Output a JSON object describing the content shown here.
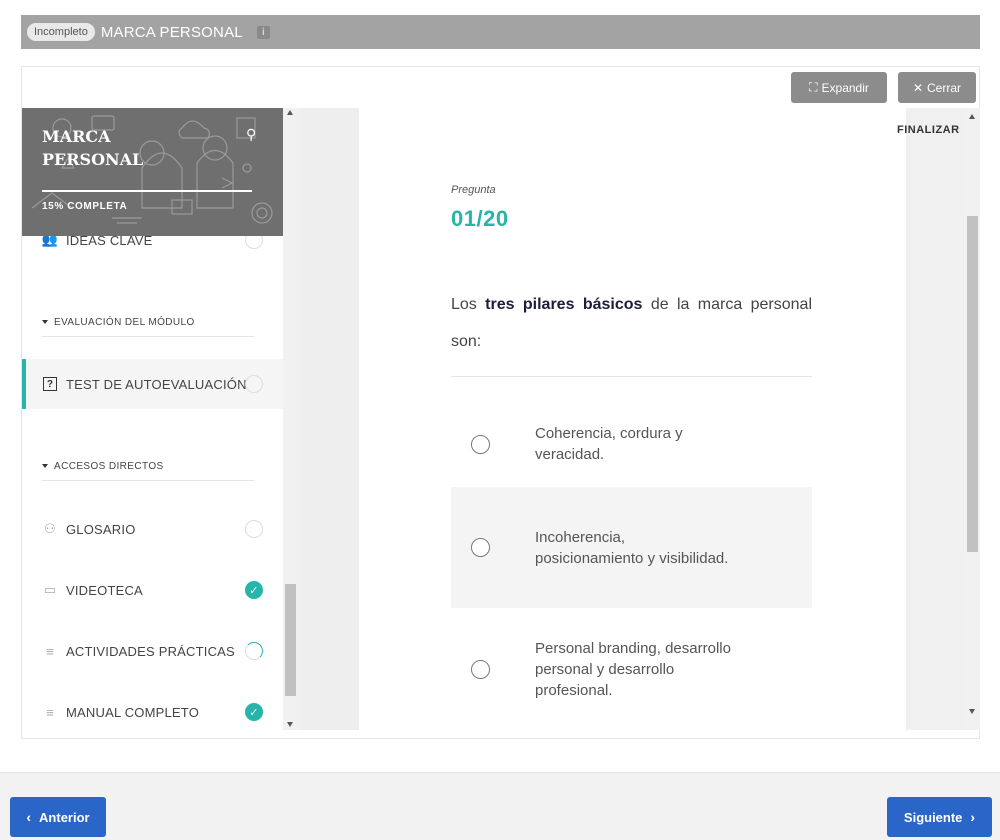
{
  "header": {
    "badge": "Incompleto",
    "title": "MARCA PERSONAL",
    "info_icon": "i"
  },
  "toolbar": {
    "expand_label": "Expandir",
    "close_label": "Cerrar"
  },
  "sidebar": {
    "course_title": "MARCA PERSONAL",
    "progress": "15% COMPLETA",
    "partial_item": "IDEAS CLAVE",
    "section_evaluation": "EVALUACIÓN DEL MÓDULO",
    "test_item": "TEST DE AUTOEVALUACIÓN",
    "section_shortcuts": "ACCESOS DIRECTOS",
    "items": [
      {
        "label": "GLOSARIO",
        "icon": "people-icon",
        "status": "empty"
      },
      {
        "label": "VIDEOTECA",
        "icon": "video-icon",
        "status": "done"
      },
      {
        "label": "ACTIVIDADES PRÁCTICAS",
        "icon": "lines-icon",
        "status": "partial"
      },
      {
        "label": "MANUAL COMPLETO",
        "icon": "lines-icon",
        "status": "done"
      }
    ]
  },
  "quiz": {
    "finalize_label": "FINALIZAR",
    "question_label": "Pregunta",
    "question_number": "01/20",
    "question_pre": "Los",
    "question_bold": "tres pilares básicos",
    "question_post": "de la marca personal son:",
    "options": [
      "Coherencia, cordura y veracidad.",
      "Incoherencia, posicionamiento y visibilidad.",
      "Personal branding, desarrollo personal y desarrollo profesional."
    ]
  },
  "navigation": {
    "prev_label": "Anterior",
    "next_label": "Siguiente"
  },
  "colors": {
    "accent": "#26b5a8",
    "nav_button": "#2a66c8",
    "header_bar": "#a3a3a3"
  }
}
